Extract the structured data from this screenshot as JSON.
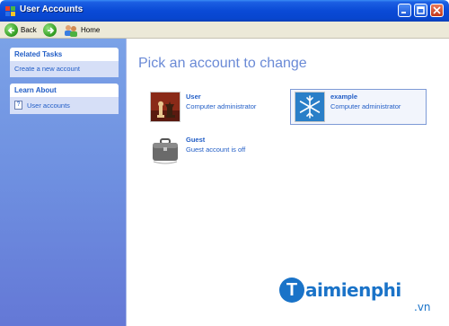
{
  "window": {
    "title": "User Accounts"
  },
  "toolbar": {
    "back_label": "Back",
    "home_label": "Home"
  },
  "sidebar": {
    "panels": [
      {
        "title": "Related Tasks",
        "items": [
          {
            "label": "Create a new account",
            "icon": ""
          }
        ]
      },
      {
        "title": "Learn About",
        "items": [
          {
            "label": "User accounts",
            "icon": "help-icon"
          }
        ]
      }
    ]
  },
  "main": {
    "title": "Pick an account to change",
    "accounts": [
      {
        "name": "User",
        "description": "Computer administrator",
        "picture": "chess-pieces",
        "selected": false
      },
      {
        "name": "example",
        "description": "Computer administrator",
        "picture": "snowflake",
        "selected": true
      },
      {
        "name": "Guest",
        "description": "Guest account is off",
        "picture": "briefcase",
        "selected": false
      }
    ]
  },
  "watermark": {
    "brand": "aimienphi",
    "logo_letter": "T",
    "suffix": ".vn"
  },
  "colors": {
    "titlebar": "#0a4ad6",
    "taskpane": "#6e8fe0",
    "link": "#215dc6",
    "heading": "#6a8ad6",
    "watermark": "#1a73c8"
  }
}
